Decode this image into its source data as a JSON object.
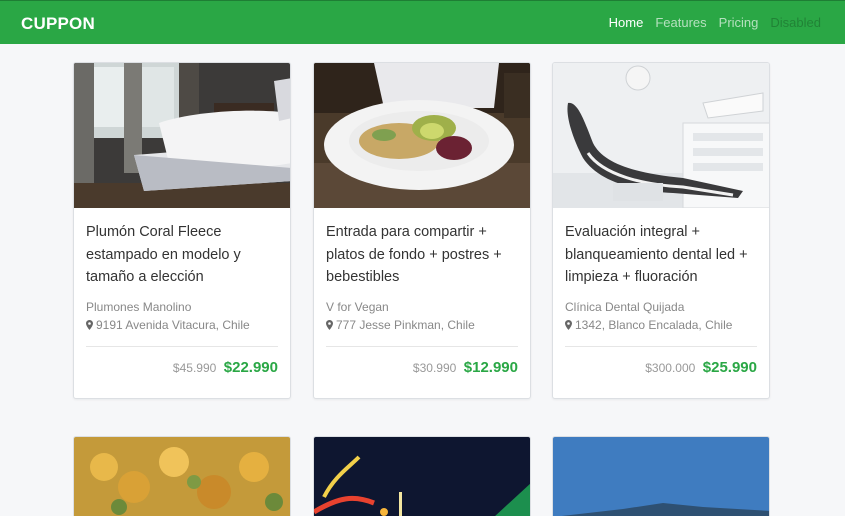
{
  "navbar": {
    "brand": "CUPPON",
    "links": [
      {
        "label": "Home",
        "state": "active"
      },
      {
        "label": "Features",
        "state": "normal"
      },
      {
        "label": "Pricing",
        "state": "normal"
      },
      {
        "label": "Disabled",
        "state": "disabled"
      }
    ]
  },
  "cards": [
    {
      "title": "Plumón Coral Fleece estampado en modelo y tamaño a elección",
      "merchant": "Plumones Manolino",
      "address": "9191 Avenida Vitacura, Chile",
      "old_price": "$45.990",
      "new_price": "$22.990",
      "image": "bedroom"
    },
    {
      "title": "Entrada para compartir + platos de fondo + postres + bebestibles",
      "merchant": "V for Vegan",
      "address": "777 Jesse Pinkman, Chile",
      "old_price": "$30.990",
      "new_price": "$12.990",
      "image": "salad-plate"
    },
    {
      "title": "Evaluación integral + blanqueamiento dental led + limpieza + fluoración",
      "merchant": "Clínica Dental Quijada",
      "address": "1342, Blanco Encalada, Chile",
      "old_price": "$300.000",
      "new_price": "$25.990",
      "image": "dental-chair"
    }
  ],
  "colors": {
    "brand_green": "#2aa745",
    "price_green": "#2aa745"
  }
}
